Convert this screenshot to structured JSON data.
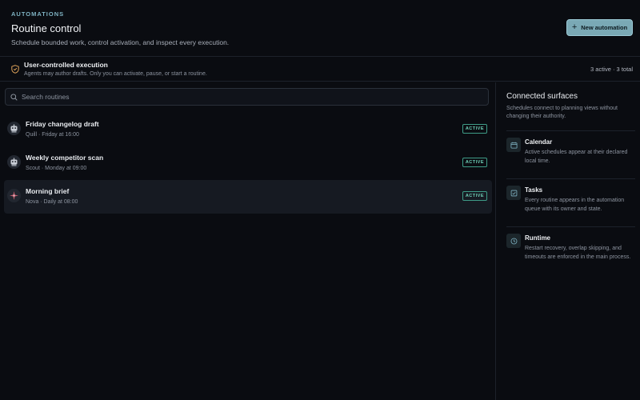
{
  "header": {
    "eyebrow": "AUTOMATIONS",
    "title": "Routine control",
    "subtitle": "Schedule bounded work, control activation, and inspect every execution.",
    "new_button_label": "New automation"
  },
  "banner": {
    "title": "User-controlled execution",
    "description": "Agents may author drafts. Only you can activate, pause, or start a routine.",
    "count": "3 active · 3 total",
    "icon": "shield-icon"
  },
  "search": {
    "placeholder": "Search routines",
    "value": ""
  },
  "routines": [
    {
      "name": "Friday changelog draft",
      "meta": "Quill · Friday at 16:00",
      "status": "ACTIVE",
      "avatar": "robot-avatar"
    },
    {
      "name": "Weekly competitor scan",
      "meta": "Scout · Monday at 09:00",
      "status": "ACTIVE",
      "avatar": "robot-avatar"
    },
    {
      "name": "Morning brief",
      "meta": "Nova · Daily at 08:00",
      "status": "ACTIVE",
      "avatar": "compass-avatar"
    }
  ],
  "side": {
    "title": "Connected surfaces",
    "description": "Schedules connect to planning views without changing their authority.",
    "surfaces": [
      {
        "title": "Calendar",
        "description": "Active schedules appear at their declared local time.",
        "icon": "calendar-icon"
      },
      {
        "title": "Tasks",
        "description": "Every routine appears in the automation queue with its owner and state.",
        "icon": "checkbox-icon"
      },
      {
        "title": "Runtime",
        "description": "Restart recovery, overlap skipping, and timeouts are enforced in the main process.",
        "icon": "clock-icon"
      }
    ]
  },
  "colors": {
    "background": "#0a0c11",
    "accent": "#7aa9b5",
    "active": "#6fd1b8",
    "warning": "#e0a35a"
  }
}
